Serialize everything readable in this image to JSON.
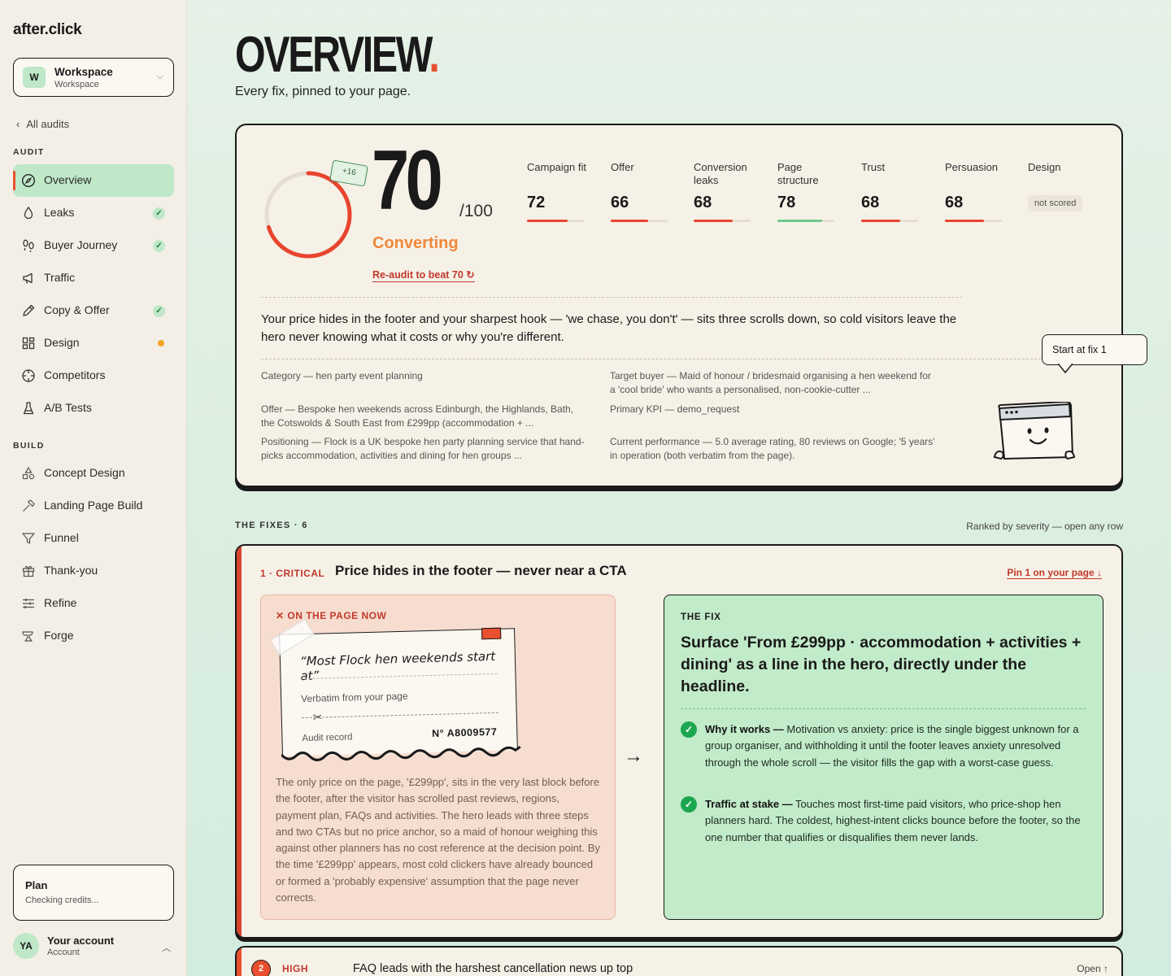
{
  "brand": {
    "name": "after.click",
    "dot": ".",
    "accent": "#e8502f"
  },
  "workspace": {
    "badge": "W",
    "name": "Workspace",
    "sub": "Workspace"
  },
  "nav": {
    "back_label": "All audits",
    "audit_heading": "AUDIT",
    "audit_items": [
      {
        "label": "Overview",
        "icon": "compass-icon",
        "status": "active"
      },
      {
        "label": "Leaks",
        "icon": "drop-icon",
        "status": "done"
      },
      {
        "label": "Buyer Journey",
        "icon": "footprints-icon",
        "status": "done"
      },
      {
        "label": "Traffic",
        "icon": "megaphone-icon",
        "status": ""
      },
      {
        "label": "Copy & Offer",
        "icon": "pen-icon",
        "status": "done"
      },
      {
        "label": "Design",
        "icon": "layout-icon",
        "status": "pending"
      },
      {
        "label": "Competitors",
        "icon": "crosshair-icon",
        "status": ""
      },
      {
        "label": "A/B Tests",
        "icon": "flask-icon",
        "status": ""
      }
    ],
    "build_heading": "BUILD",
    "build_items": [
      {
        "label": "Concept Design",
        "icon": "shapes-icon"
      },
      {
        "label": "Landing Page Build",
        "icon": "hammer-icon"
      },
      {
        "label": "Funnel",
        "icon": "funnel-icon"
      },
      {
        "label": "Thank-you",
        "icon": "gift-icon"
      },
      {
        "label": "Refine",
        "icon": "sliders-icon"
      },
      {
        "label": "Forge",
        "icon": "anvil-icon"
      }
    ]
  },
  "plan": {
    "title": "Plan",
    "sub": "Checking credits..."
  },
  "account": {
    "initials": "YA",
    "name": "Your account",
    "sub": "Account"
  },
  "page": {
    "title": "OVERVIEW",
    "title_dot": ".",
    "subtitle": "Every fix, pinned to your page."
  },
  "overview": {
    "score": 70,
    "score_text": "70",
    "score_den": "/100",
    "delta": "+16",
    "status": "Converting",
    "reaudit": "Re-audit to beat 70 ↻",
    "metrics": [
      {
        "label": "Campaign fit",
        "value": "72",
        "color": "#e8452f",
        "fill": 0.72
      },
      {
        "label": "Offer",
        "value": "66",
        "color": "#e8452f",
        "fill": 0.66
      },
      {
        "label": "Conversion leaks",
        "value": "68",
        "color": "#e8452f",
        "fill": 0.68
      },
      {
        "label": "Page structure",
        "value": "78",
        "color": "#6cc98c",
        "fill": 0.78
      },
      {
        "label": "Trust",
        "value": "68",
        "color": "#e8452f",
        "fill": 0.68
      },
      {
        "label": "Persuasion",
        "value": "68",
        "color": "#e8452f",
        "fill": 0.68
      },
      {
        "label": "Design",
        "value": "not scored",
        "color": "#aaaaaa",
        "fill": 0
      }
    ],
    "summary": "Your price hides in the footer and your sharpest hook — 'we chase, you don't' — sits three scrolls down, so cold visitors leave the hero never knowing what it costs or why you're different.",
    "facts": {
      "category": "Category — hen party event planning",
      "target": "Target buyer — Maid of honour / bridesmaid organising a hen weekend for a 'cool bride' who wants a personalised, non-cookie-cutter ...",
      "offer": "Offer — Bespoke hen weekends across Edinburgh, the Highlands, Bath, the Cotswolds & South East from £299pp (accommodation + ...",
      "kpi": "Primary KPI — demo_request",
      "positioning": "Positioning — Flock is a UK bespoke hen party planning service that hand-picks accommodation, activities and dining for hen groups ...",
      "performance": "Current performance — 5.0 average rating, 80 reviews on Google; '5 years' in operation (both verbatim from the page)."
    },
    "bubble": "Start at fix 1"
  },
  "fixes": {
    "heading": "THE FIXES · 6",
    "right": "Ranked by severity — open any row",
    "first": {
      "severity": "1 · CRITICAL",
      "title": "Price hides in the footer — never near a CTA",
      "pin": "Pin 1 on your page ↓",
      "now_heading": "✕ ON THE PAGE NOW",
      "quote": "“Most Flock hen weekends start at”",
      "verbatim": "Verbatim from your page",
      "scissors": "✂",
      "record_label": "Audit record",
      "record_no": "N° A8009577",
      "now_body": "The only price on the page, '£299pp', sits in the very last block before the footer, after the visitor has scrolled past reviews, regions, payment plan, FAQs and activities. The hero leads with three steps and two CTAs but no price anchor, so a maid of honour weighing this against other planners has no cost reference at the decision point. By the time '£299pp' appears, most cold clickers have already bounced or formed a 'probably expensive' assumption that the page never corrects.",
      "arrow": "→",
      "fix_heading": "THE FIX",
      "fix_title": "Surface 'From £299pp · accommodation + activities + dining' as a line in the hero, directly under the headline.",
      "why_label": "Why it works —",
      "why_text": " Motivation vs anxiety: price is the single biggest unknown for a group organiser, and withholding it until the footer leaves anxiety unresolved through the whole scroll — the visitor fills the gap with a worst-case guess.",
      "stake_label": "Traffic at stake —",
      "stake_text": " Touches most first-time paid visitors, who price-shop hen planners hard. The coldest, highest-intent clicks bounce before the footer, so the one number that qualifies or disqualifies them never lands."
    },
    "second": {
      "num": "2",
      "severity": "HIGH",
      "title": "FAQ leads with the harshest cancellation news up top",
      "open": "Open ↑"
    }
  }
}
